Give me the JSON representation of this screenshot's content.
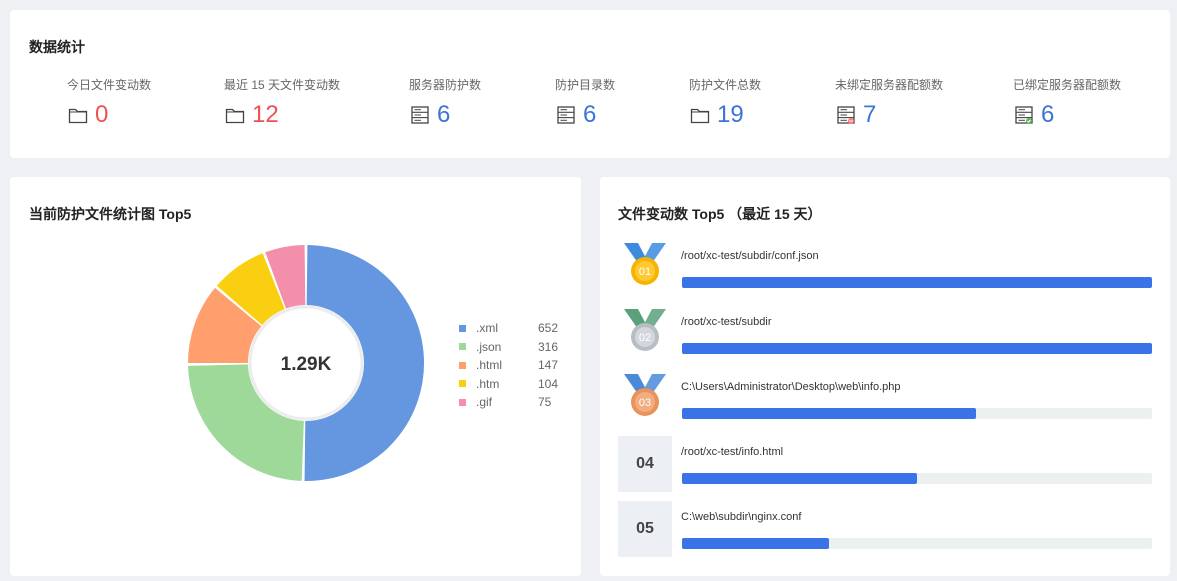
{
  "stats": {
    "title": "数据统计",
    "items": [
      {
        "label": "今日文件变动数",
        "value": "0",
        "icon": "folder-icon",
        "color": "red"
      },
      {
        "label": "最近 15 天文件变动数",
        "value": "12",
        "icon": "folder-icon",
        "color": "red"
      },
      {
        "label": "服务器防护数",
        "value": "6",
        "icon": "server-icon",
        "color": "blue"
      },
      {
        "label": "防护目录数",
        "value": "6",
        "icon": "server-icon",
        "color": "blue"
      },
      {
        "label": "防护文件总数",
        "value": "19",
        "icon": "folder-icon",
        "color": "blue"
      },
      {
        "label": "未绑定服务器配额数",
        "value": "7",
        "icon": "server-unbound-icon",
        "color": "blue"
      },
      {
        "label": "已绑定服务器配额数",
        "value": "6",
        "icon": "server-bound-icon",
        "color": "blue"
      }
    ]
  },
  "pie": {
    "title": "当前防护文件统计图 Top5",
    "center_label": "1.29K"
  },
  "chart_data": {
    "type": "pie",
    "title": "当前防护文件统计图 Top5",
    "categories": [
      ".xml",
      ".json",
      ".html",
      ".htm",
      ".gif"
    ],
    "values": [
      652,
      316,
      147,
      104,
      75
    ],
    "colors": [
      "#6497e0",
      "#9ed99a",
      "#ff9f6e",
      "#fbcf11",
      "#f48fab"
    ],
    "legend_position": "right"
  },
  "top5": {
    "title": "文件变动数 Top5 （最近 15 天）",
    "items": [
      {
        "rank": "01",
        "path": "/root/xc-test/subdir/conf.json",
        "fraction": 1.0,
        "medal": "gold"
      },
      {
        "rank": "02",
        "path": "/root/xc-test/subdir",
        "fraction": 1.0,
        "medal": "silver"
      },
      {
        "rank": "03",
        "path": "C:\\Users\\Administrator\\Desktop\\web\\info.php",
        "fraction": 0.625,
        "medal": "bronze"
      },
      {
        "rank": "04",
        "path": "/root/xc-test/info.html",
        "fraction": 0.5,
        "medal": ""
      },
      {
        "rank": "05",
        "path": "C:\\web\\subdir\\nginx.conf",
        "fraction": 0.313,
        "medal": ""
      }
    ]
  }
}
